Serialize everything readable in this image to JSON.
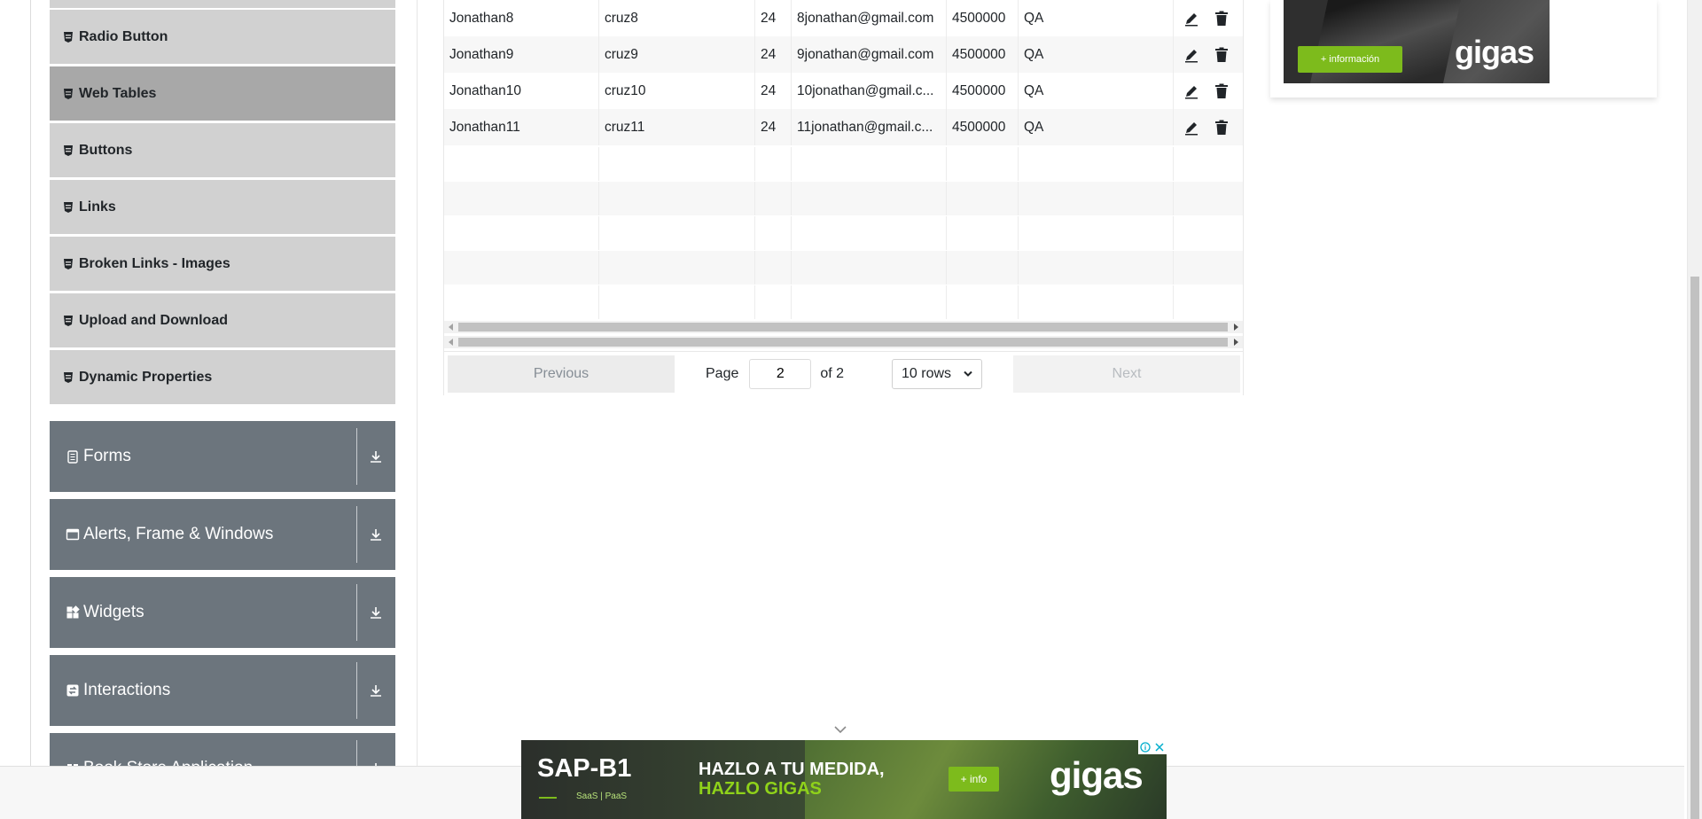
{
  "sidebar": {
    "items": [
      {
        "label": "Radio Button"
      },
      {
        "label": "Web Tables"
      },
      {
        "label": "Buttons"
      },
      {
        "label": "Links"
      },
      {
        "label": "Broken Links - Images"
      },
      {
        "label": "Upload and Download"
      },
      {
        "label": "Dynamic Properties"
      }
    ],
    "groups": [
      {
        "label": "Forms"
      },
      {
        "label": "Alerts, Frame & Windows"
      },
      {
        "label": "Widgets"
      },
      {
        "label": "Interactions"
      },
      {
        "label": "Book Store Application"
      }
    ]
  },
  "table": {
    "rows": [
      {
        "first": "Jonathan8",
        "last": "cruz8",
        "age": "24",
        "email": "8jonathan@gmail.com",
        "salary": "4500000",
        "dept": "QA"
      },
      {
        "first": "Jonathan9",
        "last": "cruz9",
        "age": "24",
        "email": "9jonathan@gmail.com",
        "salary": "4500000",
        "dept": "QA"
      },
      {
        "first": "Jonathan10",
        "last": "cruz10",
        "age": "24",
        "email": "10jonathan@gmail.c...",
        "salary": "4500000",
        "dept": "QA"
      },
      {
        "first": "Jonathan11",
        "last": "cruz11",
        "age": "24",
        "email": "11jonathan@gmail.c...",
        "salary": "4500000",
        "dept": "QA"
      }
    ]
  },
  "pager": {
    "previous_label": "Previous",
    "next_label": "Next",
    "page_label": "Page",
    "page_value": "2",
    "of_label": "of 2",
    "rows_select": "10 rows"
  },
  "ads": {
    "right": {
      "cta": "+ información",
      "logo": "gigas"
    },
    "bottom": {
      "title": "SAP-B1",
      "subtitle": "SaaS | PaaS",
      "headline_1": "HAZLO A TU MEDIDA,",
      "headline_2": "HAZLO GIGAS",
      "cta": "+ info",
      "logo": "gigas"
    }
  },
  "colors": {
    "menu_item_bg": "#d1d1d1",
    "menu_item_active_bg": "#a8a8a8",
    "group_bg": "#6c757d",
    "accent_green": "#7dbb1c"
  }
}
